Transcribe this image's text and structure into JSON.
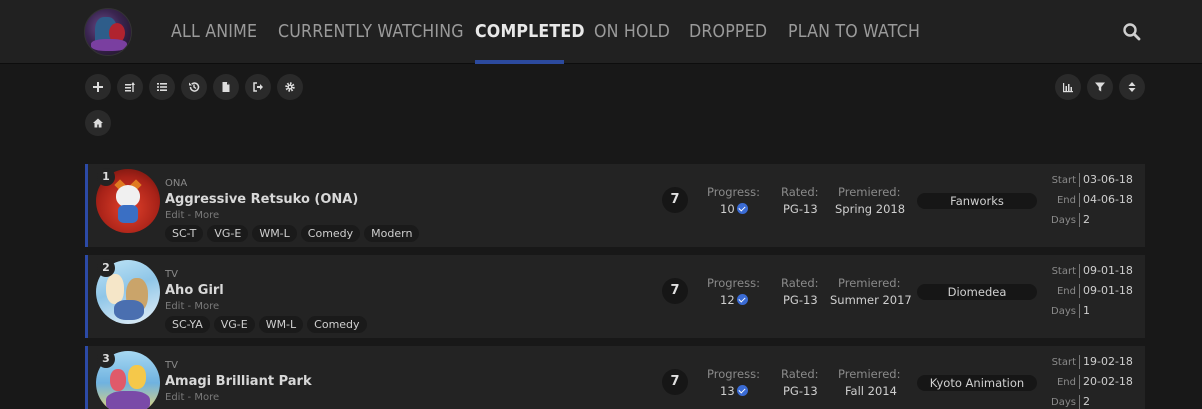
{
  "nav": {
    "tabs": [
      {
        "label": "ALL ANIME"
      },
      {
        "label": "CURRENTLY WATCHING"
      },
      {
        "label": "COMPLETED"
      },
      {
        "label": "ON HOLD"
      },
      {
        "label": "DROPPED"
      },
      {
        "label": "PLAN TO WATCH"
      }
    ],
    "active_tab": "COMPLETED"
  },
  "toolbar": {
    "left_icons": [
      "add-icon",
      "sort-az-icon",
      "list-icon",
      "history-icon",
      "file-icon",
      "export-icon",
      "settings-icon"
    ],
    "home_icon": "home-icon",
    "right_icons": [
      "stats-icon",
      "filter-icon",
      "sort-icon"
    ]
  },
  "labels": {
    "progress": "Progress:",
    "rated": "Rated:",
    "premiered": "Premiered:",
    "start": "Start",
    "end": "End",
    "days": "Days",
    "edit": "Edit",
    "sep": " - ",
    "more": "More"
  },
  "entries": [
    {
      "rank": "1",
      "type": "ONA",
      "title": "Aggressive Retsuko (ONA)",
      "tags": [
        "SC-T",
        "VG-E",
        "WM-L",
        "Comedy",
        "Modern"
      ],
      "score": "7",
      "progress": "10",
      "rated": "PG-13",
      "premiered": "Spring 2018",
      "studio": "Fanworks",
      "start": "03-06-18",
      "end": "04-06-18",
      "days": "2"
    },
    {
      "rank": "2",
      "type": "TV",
      "title": "Aho Girl",
      "tags": [
        "SC-YA",
        "VG-E",
        "WM-L",
        "Comedy"
      ],
      "score": "7",
      "progress": "12",
      "rated": "PG-13",
      "premiered": "Summer 2017",
      "studio": "Diomedea",
      "start": "09-01-18",
      "end": "09-01-18",
      "days": "1"
    },
    {
      "rank": "3",
      "type": "TV",
      "title": "Amagi Brilliant Park",
      "tags": [],
      "score": "7",
      "progress": "13",
      "rated": "PG-13",
      "premiered": "Fall 2014",
      "studio": "Kyoto Animation",
      "start": "19-02-18",
      "end": "20-02-18",
      "days": "2"
    }
  ],
  "colors": {
    "accent": "#2c4a9e",
    "check": "#3a6bd4",
    "background": "#181818",
    "row": "#232323"
  }
}
